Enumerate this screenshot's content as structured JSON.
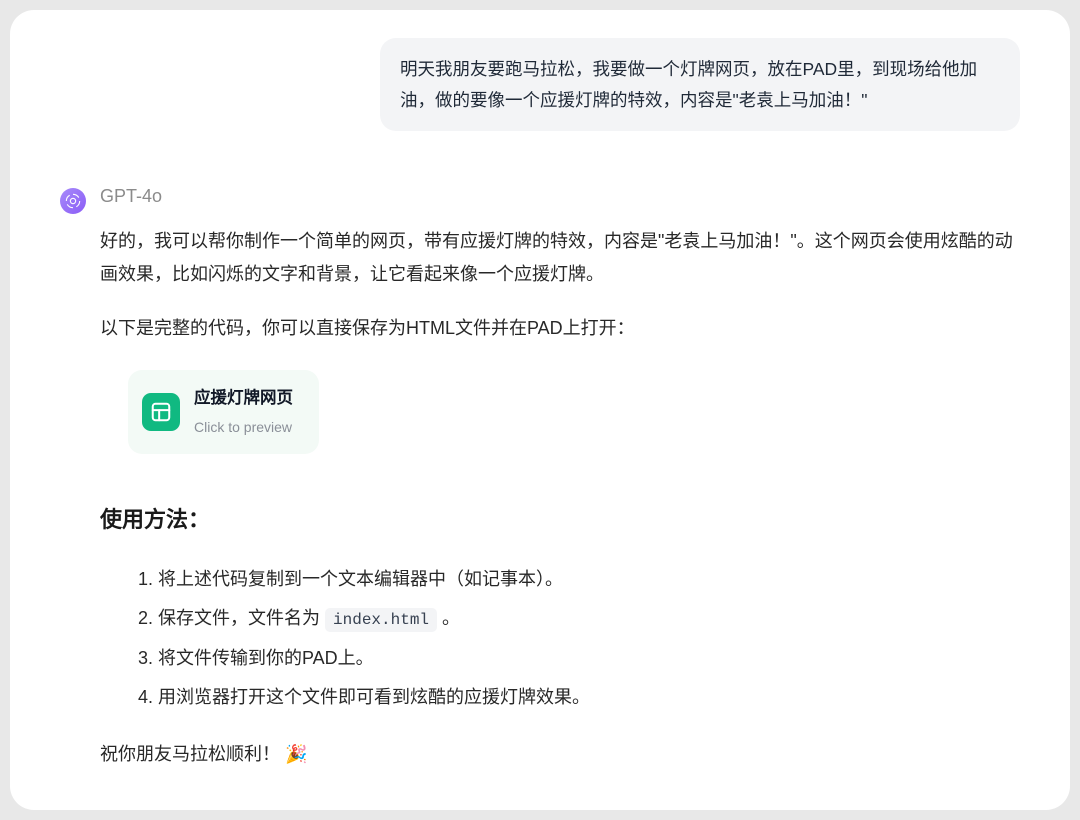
{
  "user_message": "明天我朋友要跑马拉松，我要做一个灯牌网页，放在PAD里，到现场给他加油，做的要像一个应援灯牌的特效，内容是\"老袁上马加油！\"",
  "assistant": {
    "model_name": "GPT-4o",
    "para1": "好的，我可以帮你制作一个简单的网页，带有应援灯牌的特效，内容是\"老袁上马加油！\"。这个网页会使用炫酷的动画效果，比如闪烁的文字和背景，让它看起来像一个应援灯牌。",
    "para2": "以下是完整的代码，你可以直接保存为HTML文件并在PAD上打开：",
    "preview": {
      "title": "应援灯牌网页",
      "subtitle": "Click to preview"
    },
    "usage_heading": "使用方法：",
    "steps": {
      "s1": "将上述代码复制到一个文本编辑器中（如记事本）。",
      "s2a": "保存文件，文件名为 ",
      "s2_code": "index.html",
      "s2b": " 。",
      "s3": "将文件传输到你的PAD上。",
      "s4": "用浏览器打开这个文件即可看到炫酷的应援灯牌效果。"
    },
    "closing_text": "祝你朋友马拉松顺利！",
    "closing_emoji": "🎉"
  }
}
